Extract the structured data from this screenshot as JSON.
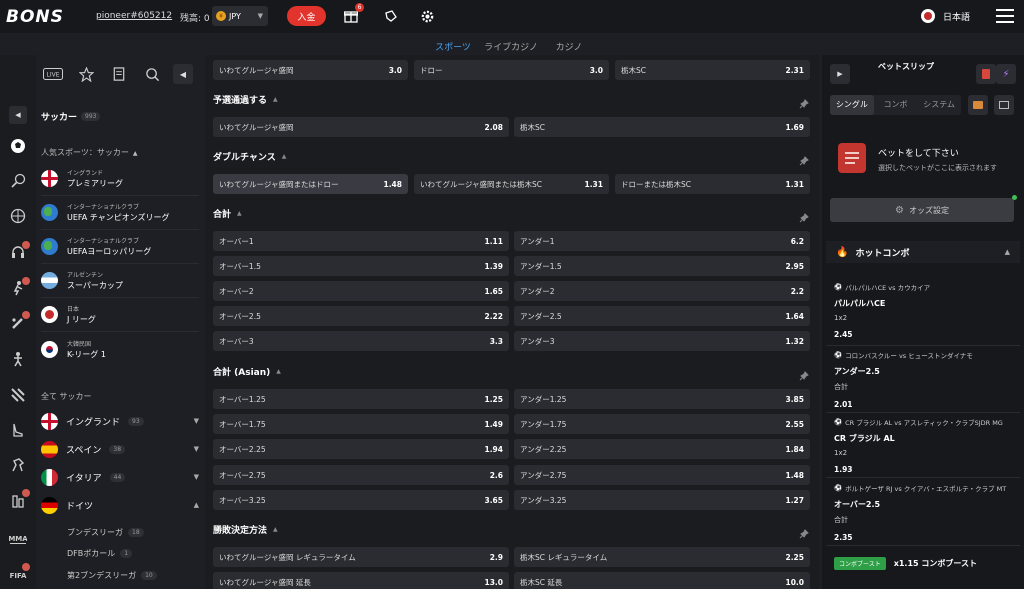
{
  "header": {
    "logo": "BONS",
    "username": "pioneer#605212",
    "balance_label": "残高: 0",
    "currency": "JPY",
    "deposit_label": "入金",
    "gift_badge": "6",
    "language": "日本語"
  },
  "mode_tabs": [
    "スポーツ",
    "ライブカジノ",
    "カジノ"
  ],
  "sidebar": {
    "title": "サッカー",
    "title_count": "993",
    "popular_label": "人気スポーツ：サッカー",
    "popular_leagues": [
      {
        "region": "イングランド",
        "name": "プレミアリーグ"
      },
      {
        "region": "インターナショナルクラブ",
        "name": "UEFA チャンピオンズリーグ"
      },
      {
        "region": "インターナショナルクラブ",
        "name": "UEFAヨーロッパリーグ"
      },
      {
        "region": "アルゼンチン",
        "name": "スーパーカップ"
      },
      {
        "region": "日本",
        "name": "J リーグ"
      },
      {
        "region": "大韓民国",
        "name": "K-リーグ 1"
      }
    ],
    "all_label": "全て サッカー",
    "countries": [
      {
        "name": "イングランド",
        "count": "93"
      },
      {
        "name": "スペイン",
        "count": "38"
      },
      {
        "name": "イタリア",
        "count": "44"
      },
      {
        "name": "ドイツ",
        "count": ""
      }
    ],
    "subleagues": [
      {
        "name": "ブンデスリーガ",
        "count": "18"
      },
      {
        "name": "DFBポカール",
        "count": "1"
      },
      {
        "name": "第2ブンデスリーガ",
        "count": "10"
      }
    ]
  },
  "markets": {
    "top_row": [
      {
        "label": "いわてグルージャ盛岡",
        "value": "3.0"
      },
      {
        "label": "ドロー",
        "value": "3.0"
      },
      {
        "label": "栃木SC",
        "value": "2.31"
      }
    ],
    "qualify": {
      "title": "予選通過する",
      "odds": [
        {
          "label": "いわてグルージャ盛岡",
          "value": "2.08"
        },
        {
          "label": "栃木SC",
          "value": "1.69"
        }
      ]
    },
    "double": {
      "title": "ダブルチャンス",
      "odds": [
        {
          "label": "いわてグルージャ盛岡またはドロー",
          "value": "1.48"
        },
        {
          "label": "いわてグルージャ盛岡または栃木SC",
          "value": "1.31"
        },
        {
          "label": "ドローまたは栃木SC",
          "value": "1.31"
        }
      ]
    },
    "total": {
      "title": "合計",
      "rows": [
        [
          {
            "label": "オーバー1",
            "value": "1.11"
          },
          {
            "label": "アンダー1",
            "value": "6.2"
          }
        ],
        [
          {
            "label": "オーバー1.5",
            "value": "1.39"
          },
          {
            "label": "アンダー1.5",
            "value": "2.95"
          }
        ],
        [
          {
            "label": "オーバー2",
            "value": "1.65"
          },
          {
            "label": "アンダー2",
            "value": "2.2"
          }
        ],
        [
          {
            "label": "オーバー2.5",
            "value": "2.22"
          },
          {
            "label": "アンダー2.5",
            "value": "1.64"
          }
        ],
        [
          {
            "label": "オーバー3",
            "value": "3.3"
          },
          {
            "label": "アンダー3",
            "value": "1.32"
          }
        ]
      ]
    },
    "asian": {
      "title": "合計 (Asian)",
      "rows": [
        [
          {
            "label": "オーバー1.25",
            "value": "1.25"
          },
          {
            "label": "アンダー1.25",
            "value": "3.85"
          }
        ],
        [
          {
            "label": "オーバー1.75",
            "value": "1.49"
          },
          {
            "label": "アンダー1.75",
            "value": "2.55"
          }
        ],
        [
          {
            "label": "オーバー2.25",
            "value": "1.94"
          },
          {
            "label": "アンダー2.25",
            "value": "1.84"
          }
        ],
        [
          {
            "label": "オーバー2.75",
            "value": "2.6"
          },
          {
            "label": "アンダー2.75",
            "value": "1.48"
          }
        ],
        [
          {
            "label": "オーバー3.25",
            "value": "3.65"
          },
          {
            "label": "アンダー3.25",
            "value": "1.27"
          }
        ]
      ]
    },
    "method": {
      "title": "勝敗決定方法",
      "rows": [
        [
          {
            "label": "いわてグルージャ盛岡 レギュラータイム",
            "value": "2.9"
          },
          {
            "label": "栃木SC レギュラータイム",
            "value": "2.25"
          }
        ],
        [
          {
            "label": "いわてグルージャ盛岡 延長",
            "value": "13.0"
          },
          {
            "label": "栃木SC 延長",
            "value": "10.0"
          }
        ]
      ]
    }
  },
  "betslip": {
    "title": "ベットスリップ",
    "tabs": [
      "シングル",
      "コンボ",
      "システム"
    ],
    "empty_title": "ベットをして下さい",
    "empty_sub": "選択したベットがここに表示されます",
    "odds_settings": "オッズ設定"
  },
  "hot_combo": {
    "title": "ホットコンボ",
    "items": [
      {
        "match": "パルパルハCE vs カウカイア",
        "pick": "パルパルハCE",
        "type": "1x2",
        "odd": "2.45"
      },
      {
        "match": "コロンバスクルー vs ヒューストンダイナモ",
        "pick": "アンダー2.5",
        "type": "合計",
        "odd": "2.01"
      },
      {
        "match": "CR ブラジル AL vs アスレティック・クラブSJDR MG",
        "pick": "CR ブラジル AL",
        "type": "1x2",
        "odd": "1.93"
      },
      {
        "match": "ボルトゲーザ RJ vs クイアバ・エスポルテ・クラブ MT",
        "pick": "オーバー2.5",
        "type": "合計",
        "odd": "2.35"
      }
    ],
    "boost_tag": "コンボブースト",
    "boost_text": "x1.15 コンボブースト"
  },
  "colors": {
    "accent_red": "#e2332c",
    "boost_green": "#2e9e47",
    "tab_blue": "#3f8fd8"
  }
}
